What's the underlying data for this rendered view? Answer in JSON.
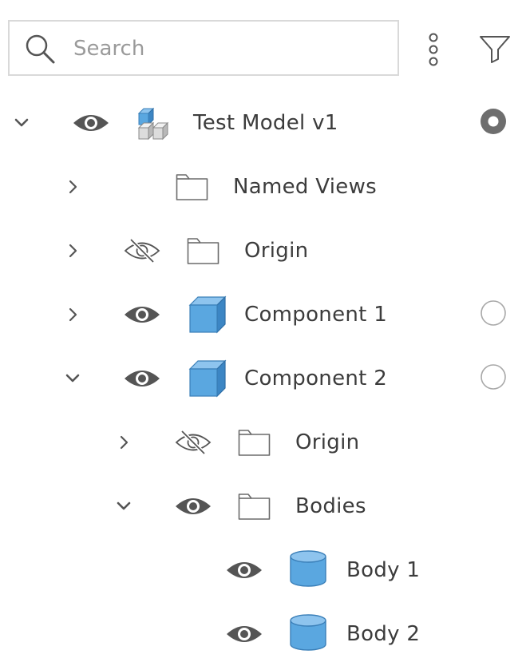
{
  "search": {
    "value": "",
    "placeholder": "Search"
  },
  "icons": {
    "search": "search-icon",
    "more": "more-vertical-icon",
    "filter": "filter-icon",
    "chevron_expanded": "chevron-down-icon",
    "chevron_collapsed": "chevron-right-icon",
    "visible": "eye-icon",
    "hidden": "eye-slash-icon",
    "assembly": "assembly-icon",
    "folder": "folder-icon",
    "component": "component-cube-icon",
    "body": "body-cylinder-icon",
    "radio": "activate-radio-icon"
  },
  "colors": {
    "accent_blue": "#5aa7e0",
    "icon_gray": "#555555",
    "text": "#3c3c3c"
  },
  "tree": {
    "items": [
      {
        "label": "Test Model v1",
        "depth": 0,
        "expanded": true,
        "visible": true,
        "type": "assembly",
        "radio": "active"
      },
      {
        "label": "Named Views",
        "depth": 1,
        "expanded": false,
        "visible": null,
        "type": "folder",
        "radio": "none"
      },
      {
        "label": "Origin",
        "depth": 1,
        "expanded": false,
        "visible": false,
        "type": "folder",
        "radio": "none"
      },
      {
        "label": "Component 1",
        "depth": 1,
        "expanded": false,
        "visible": true,
        "type": "component",
        "radio": "inactive"
      },
      {
        "label": "Component 2",
        "depth": 1,
        "expanded": true,
        "visible": true,
        "type": "component",
        "radio": "inactive"
      },
      {
        "label": "Origin",
        "depth": 2,
        "expanded": false,
        "visible": false,
        "type": "folder",
        "radio": "none"
      },
      {
        "label": "Bodies",
        "depth": 2,
        "expanded": true,
        "visible": true,
        "type": "folder",
        "radio": "none"
      },
      {
        "label": "Body 1",
        "depth": 3,
        "expanded": null,
        "visible": true,
        "type": "body",
        "radio": "none"
      },
      {
        "label": "Body 2",
        "depth": 3,
        "expanded": null,
        "visible": true,
        "type": "body",
        "radio": "none"
      }
    ]
  }
}
